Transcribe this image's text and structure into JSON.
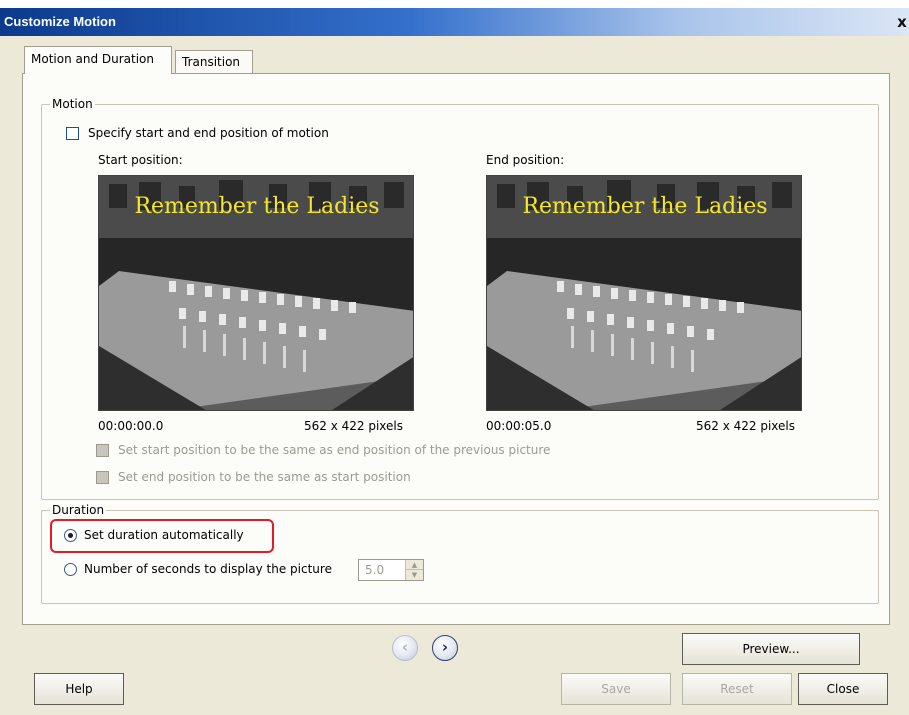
{
  "window": {
    "title": "Customize Motion",
    "close_glyph": "x"
  },
  "tabs": [
    {
      "label": "Motion and Duration",
      "active": true
    },
    {
      "label": "Transition",
      "active": false
    }
  ],
  "motion": {
    "legend": "Motion",
    "specify_label": "Specify start and end position of motion",
    "specify_checked": false,
    "start": {
      "heading": "Start position:",
      "caption_text": "Remember the Ladies",
      "time": "00:00:00.0",
      "size": "562 x 422 pixels"
    },
    "end": {
      "heading": "End position:",
      "caption_text": "Remember the Ladies",
      "time": "00:00:05.0",
      "size": "562 x 422 pixels"
    },
    "same_as_prev_label": "Set start position to be the same as end position of the previous picture",
    "same_as_start_label": "Set end position to be the same as start position"
  },
  "duration": {
    "legend": "Duration",
    "auto_label": "Set duration automatically",
    "auto_selected": true,
    "manual_label": "Number of seconds to display the picture",
    "seconds_value": "5.0"
  },
  "nav": {
    "prev_glyph": "‹",
    "next_glyph": "›"
  },
  "buttons": {
    "preview": "Preview...",
    "help": "Help",
    "save": "Save",
    "reset": "Reset",
    "close": "Close"
  },
  "colors": {
    "highlight": "#e21c24",
    "caption_yellow": "#f5e82a",
    "title_gradient_start": "#0b3a8c"
  }
}
